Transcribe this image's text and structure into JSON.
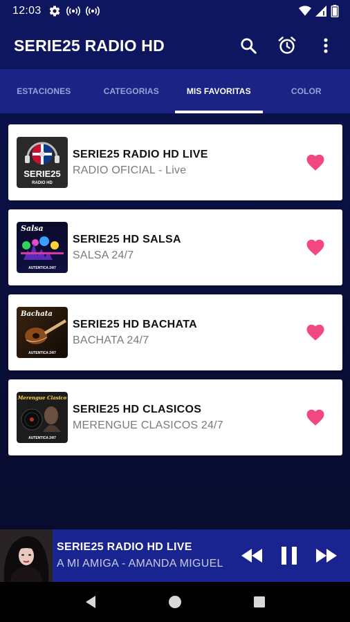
{
  "status_bar": {
    "time": "12:03",
    "left_icons": [
      "gear-icon",
      "radio-broadcast-icon",
      "radio-broadcast-icon"
    ],
    "right_icons": [
      "wifi-icon",
      "signal-icon",
      "battery-icon"
    ]
  },
  "app_bar": {
    "title": "SERIE25 RADIO HD",
    "actions": [
      "search-icon",
      "alarm-icon",
      "more-vert-icon"
    ]
  },
  "tabs": [
    {
      "label": "ESTACIONES",
      "active": false
    },
    {
      "label": "CATEGORIAS",
      "active": false
    },
    {
      "label": "MIS FAVORITAS",
      "active": true
    },
    {
      "label": "COLOR",
      "active": false
    }
  ],
  "stations": [
    {
      "title": "SERIE25 RADIO HD LIVE",
      "subtitle": "RADIO OFICIAL - Live",
      "logo_text": "SERIE25",
      "logo_subtext": "RADIO HD",
      "favorite": true
    },
    {
      "title": "SERIE25 HD SALSA",
      "subtitle": "SALSA 24/7",
      "logo_text": "Salsa",
      "logo_subtext": "AUTENTICA 24/7",
      "favorite": true
    },
    {
      "title": "SERIE25 HD BACHATA",
      "subtitle": "BACHATA 24/7",
      "logo_text": "Bachata",
      "logo_subtext": "AUTENTICA 24/7",
      "favorite": true
    },
    {
      "title": "SERIE25 HD CLASICOS",
      "subtitle": "MERENGUE CLASICOS 24/7",
      "logo_text": "Merengue Clasico",
      "logo_subtext": "AUTENTICA 24/7",
      "favorite": true
    }
  ],
  "player": {
    "title": "SERIE25 RADIO HD LIVE",
    "subtitle": "A MI AMIGA - AMANDA MIGUEL",
    "controls": [
      "rewind-icon",
      "pause-icon",
      "fast-forward-icon"
    ]
  },
  "nav_bar": [
    "back-icon",
    "home-icon",
    "recents-icon"
  ],
  "colors": {
    "primary": "#0e1660",
    "tab_bg": "#1b2485",
    "player_bg": "#1a2490",
    "heart": "#f0487f"
  }
}
